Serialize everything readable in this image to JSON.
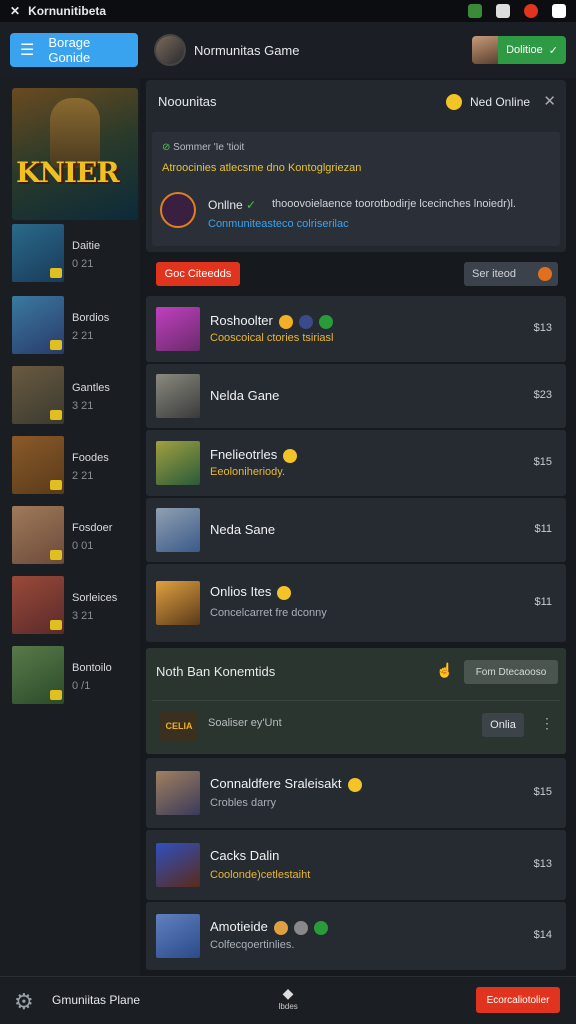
{
  "statusbar": {
    "app_label": "Kornunitibeta"
  },
  "topbar": {
    "menu_label": "Borage Gonide",
    "title": "Normunitas Game",
    "action_label": "Dolitioe"
  },
  "sidebar": {
    "hero_logo": "KNIER",
    "items": [
      {
        "name": "Daitie",
        "num": "0 21",
        "colors": [
          "#1a3a5a",
          "#2a6a8a"
        ]
      },
      {
        "name": "Bordios",
        "num": "2 21",
        "colors": [
          "#2a3a6a",
          "#3a7aa0"
        ]
      },
      {
        "name": "Gantles",
        "num": "3 21",
        "colors": [
          "#3a3a30",
          "#6a5a40"
        ]
      },
      {
        "name": "Foodes",
        "num": "2 21",
        "colors": [
          "#5a3a1a",
          "#8a5a2a"
        ]
      },
      {
        "name": "Fosdoer",
        "num": "0 01",
        "colors": [
          "#6a4a3a",
          "#a07a5a"
        ]
      },
      {
        "name": "Sorleices",
        "num": "3 21",
        "colors": [
          "#5a2a2a",
          "#9a4a3a"
        ]
      },
      {
        "name": "Bontoilo",
        "num": "0 /1",
        "colors": [
          "#2a4a2a",
          "#5a7a4a"
        ]
      }
    ]
  },
  "panel": {
    "title": "Noounitas",
    "status": "Ned Online",
    "line1": "Sommer 'Ie 'tioit",
    "line2": "Atroocinies atlecsme dno Kontoglgriezan",
    "online_label": "Onllne",
    "online_text": "thooovoielaence toorotbodirje lcecinches lnoiedr)l.",
    "link": "Conmuniteasteco colriserilac"
  },
  "buttons": {
    "red": "Goc Citeedds",
    "gray": "Ser iteod"
  },
  "games": [
    {
      "name": "Roshoolter",
      "sub": "Cooscoical ctories tsiriasl",
      "sub_style": "gold",
      "price": "$13",
      "colors": [
        "#6a2a6a",
        "#c040c0"
      ]
    },
    {
      "name": "Nelda Gane",
      "sub": "",
      "sub_style": "gold",
      "price": "$23",
      "colors": [
        "#3a3a3a",
        "#8a8a80"
      ]
    },
    {
      "name": "Fnelieotrles",
      "sub": "Eeoloniheriody.",
      "sub_style": "gold",
      "price": "$15",
      "colors": [
        "#2a5a3a",
        "#a0a040"
      ]
    },
    {
      "name": "Neda Sane",
      "sub": "",
      "sub_style": "gold",
      "price": "$11",
      "colors": [
        "#3a5a8a",
        "#90a0b0"
      ]
    },
    {
      "name": "Onlios Ites",
      "sub": "Concelcarret fre dconny",
      "sub_style": "gray",
      "price": "$11",
      "colors": [
        "#5a3a1a",
        "#e0a040"
      ]
    }
  ],
  "section": {
    "title": "Noth Ban Konemtids",
    "button": "Fom Dtecaooso",
    "logo": "CELIA",
    "text": "Soaliser ey'Unt",
    "online": "Onlia"
  },
  "games2": [
    {
      "name": "Connaldfere Sraleisakt",
      "sub": "Crobles darry",
      "sub_style": "gray",
      "price": "$15",
      "colors": [
        "#3a3a5a",
        "#a08060"
      ]
    },
    {
      "name": "Cacks Dalin",
      "sub": "Coolonde)cetlestaiht",
      "sub_style": "gold",
      "price": "$13",
      "colors": [
        "#5a2a1a",
        "#3050c0"
      ]
    },
    {
      "name": "Amotieide",
      "sub": "Colfecqoertinlies.",
      "sub_style": "gray",
      "price": "$14",
      "colors": [
        "#2a4a8a",
        "#6080c0"
      ]
    }
  ],
  "bottom": {
    "title": "Gmuniitas Plane",
    "center_label": "Ibdes",
    "button": "Ecorcaliotolier"
  }
}
